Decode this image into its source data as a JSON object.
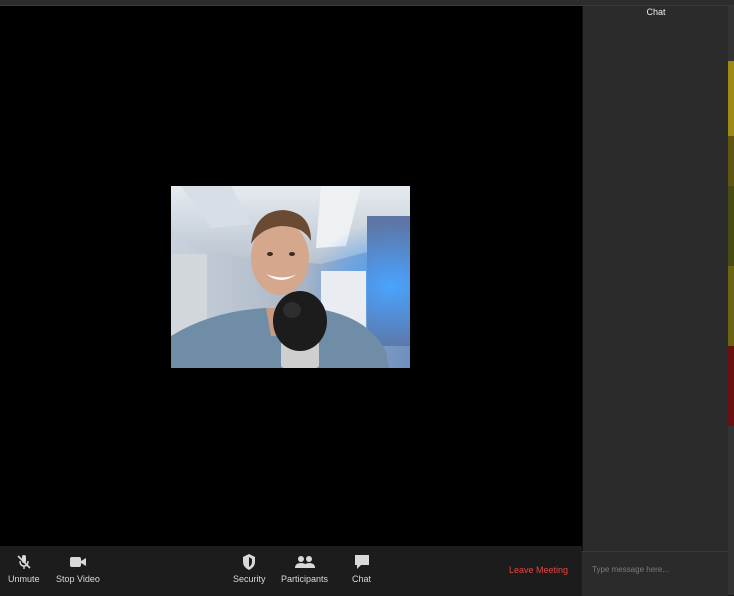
{
  "chat": {
    "title": "Chat",
    "input_placeholder": "Type message here..."
  },
  "toolbar": {
    "unmute_label": "Unmute",
    "stop_video_label": "Stop Video",
    "security_label": "Security",
    "participants_label": "Participants",
    "chat_label": "Chat",
    "leave_label": "Leave Meeting"
  },
  "icons": {
    "unmute": "muted-microphone-icon",
    "stop_video": "video-camera-icon",
    "security": "shield-icon",
    "participants": "participants-icon",
    "chat": "chat-bubble-icon"
  },
  "colors": {
    "leave_meeting": "#e0473f",
    "toolbar_bg": "#1c1c1c",
    "chat_panel_bg": "#2b2b2b"
  }
}
